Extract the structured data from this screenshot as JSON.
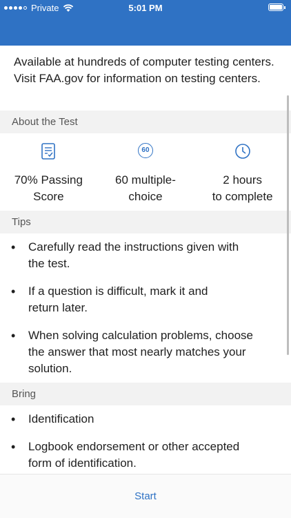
{
  "status_bar": {
    "carrier": "Private",
    "time": "5:01 PM"
  },
  "intro_text": "Available at hundreds of computer testing centers. Visit FAA.gov for information on testing centers.",
  "about": {
    "heading": "About the Test",
    "stats": [
      {
        "icon": "checklist-icon",
        "line1": "70% Passing",
        "line2": "Score"
      },
      {
        "icon": "sixty-badge-icon",
        "icon_text": "60",
        "line1": "60 multiple-",
        "line2": "choice"
      },
      {
        "icon": "clock-icon",
        "line1": "2 hours",
        "line2": "to complete"
      }
    ]
  },
  "tips": {
    "heading": "Tips",
    "items": [
      {
        "line1": "Carefully read the instructions given with",
        "line2": "the test."
      },
      {
        "line1": "If a question is difficult, mark it and",
        "line2": "return later."
      },
      {
        "line1": "When solving calculation problems, choose",
        "line2": "the answer that most nearly matches your",
        "line3": "solution."
      }
    ]
  },
  "bring": {
    "heading": "Bring",
    "items": [
      {
        "line1": "Identification"
      },
      {
        "line1": "Logbook endorsement or other accepted",
        "line2": "form of identification."
      }
    ]
  },
  "footer": {
    "start_label": "Start"
  },
  "colors": {
    "accent": "#2f72c4",
    "section_bg": "#f2f2f2"
  }
}
